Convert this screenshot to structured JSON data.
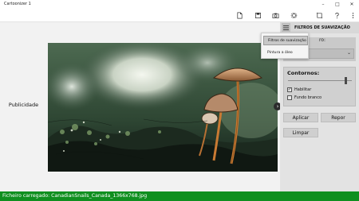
{
  "app": {
    "title": "Cartoonizer 1"
  },
  "toolbar": {
    "icons": [
      "new-file-icon",
      "save-icon",
      "camera-icon",
      "settings-icon",
      "crop-icon",
      "help-icon",
      "more-icon"
    ]
  },
  "left_panel": {
    "ad_label": "Publicidade"
  },
  "right_panel": {
    "title": "FILTROS DE SUAVIZAÇÃO",
    "dropdown_label": "ro:",
    "dropdown_value": "",
    "contours_title": "Contornos:",
    "contours_slider_level": 0.9,
    "enable_label": "Habilitar",
    "enable_checked": true,
    "white_bg_label": "Fundo branco",
    "white_bg_checked": false,
    "apply_label": "Aplicar",
    "reset_label": "Repor",
    "clear_label": "Limpar"
  },
  "menu": {
    "items": [
      "Filtros de suavização",
      "Pintura a óleo"
    ],
    "selected_index": 0
  },
  "status": {
    "text": "Ficheiro carregado: CanadianSnails_Canada_1366x768.jpg"
  },
  "colors": {
    "status_bar": "#0f8f1f",
    "panel": "#e3e3e3"
  }
}
